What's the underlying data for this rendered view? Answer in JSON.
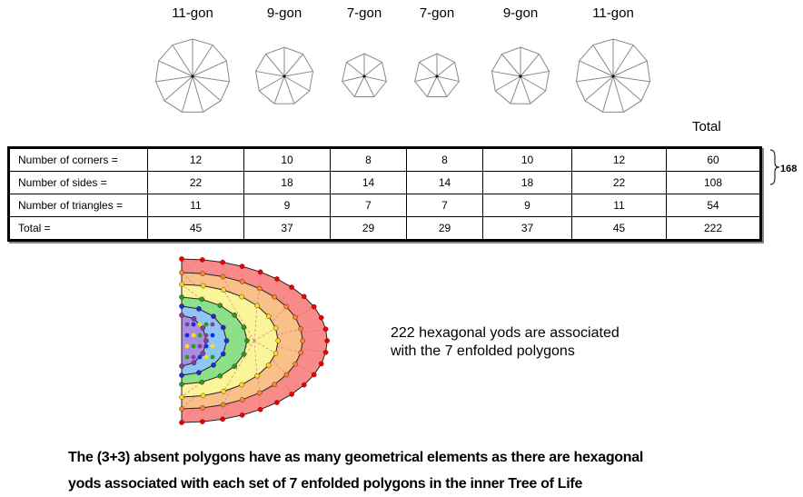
{
  "polygons": [
    {
      "label": "11-gon",
      "sides": 11
    },
    {
      "label": "9-gon",
      "sides": 9
    },
    {
      "label": "7-gon",
      "sides": 7
    },
    {
      "label": "7-gon",
      "sides": 7
    },
    {
      "label": "9-gon",
      "sides": 9
    },
    {
      "label": "11-gon",
      "sides": 11
    }
  ],
  "table": {
    "total_header": "Total",
    "rows": [
      {
        "label": "Number of corners =",
        "values": [
          "12",
          "10",
          "8",
          "8",
          "10",
          "12",
          "60"
        ]
      },
      {
        "label": "Number of sides =",
        "values": [
          "22",
          "18",
          "14",
          "14",
          "18",
          "22",
          "108"
        ]
      },
      {
        "label": "Number of triangles =",
        "values": [
          "11",
          "9",
          "7",
          "7",
          "9",
          "11",
          "54"
        ]
      },
      {
        "label": "Total =",
        "values": [
          "45",
          "37",
          "29",
          "29",
          "37",
          "45",
          "222"
        ]
      }
    ],
    "brace_total": "168"
  },
  "figure": {
    "caption_line1": "222 hexagonal yods are associated",
    "caption_line2": "with the 7 enfolded polygons",
    "layer_colors": [
      "#f88a8a",
      "#f9c08a",
      "#fbf59a",
      "#8de08a",
      "#8ec5f5",
      "#a98de0"
    ]
  },
  "footer": {
    "line1": "The (3+3) absent polygons have as many geometrical elements as there are hexagonal",
    "line2": "yods associated with each set of 7 enfolded polygons in the inner Tree of Life"
  }
}
